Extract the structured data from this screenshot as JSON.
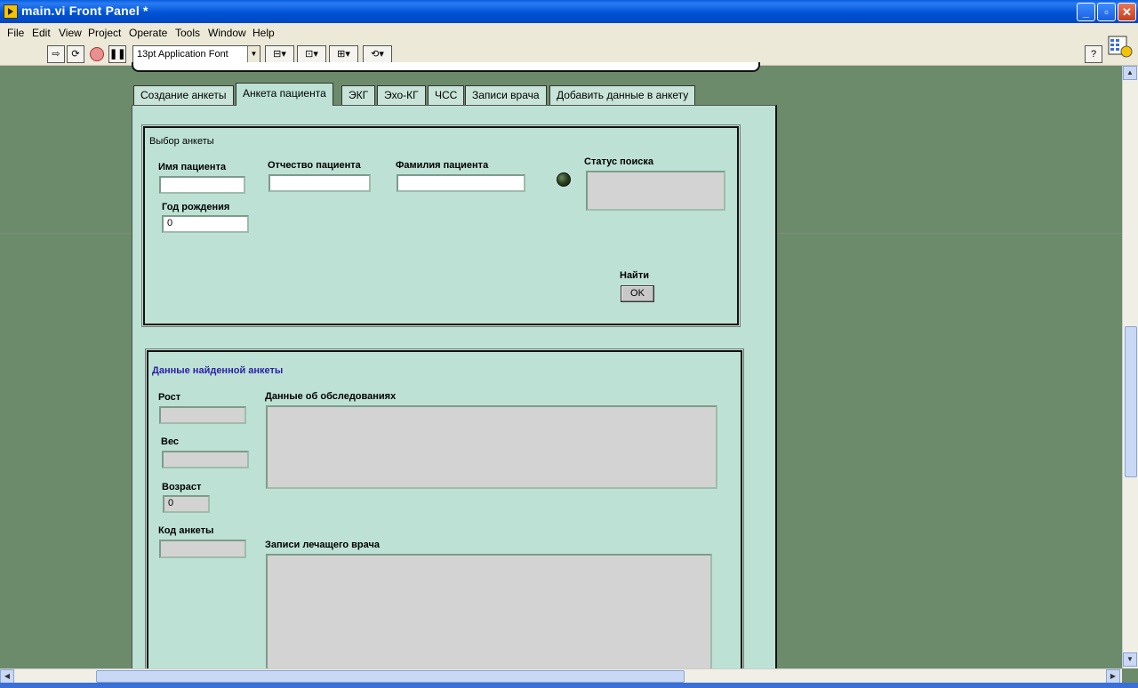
{
  "window": {
    "title": "main.vi Front Panel *"
  },
  "menu": [
    "File",
    "Edit",
    "View",
    "Project",
    "Operate",
    "Tools",
    "Window",
    "Help"
  ],
  "toolbar": {
    "font": "13pt Application Font"
  },
  "tabs": [
    "Создание анкеты",
    "Анкета пациента",
    "ЭКГ",
    "Эхо-КГ",
    "ЧСС",
    "Записи врача",
    "Добавить данные в анкету"
  ],
  "search_group": {
    "title": "Выбор анкеты",
    "first_name_label": "Имя пациента",
    "first_name_value": "",
    "patronymic_label": "Отчество пациента",
    "patronymic_value": "",
    "surname_label": "Фамилия пациента",
    "surname_value": "",
    "birth_year_label": "Год рождения",
    "birth_year_value": "0",
    "status_label": "Статус поиска",
    "status_value": "",
    "find_label": "Найти",
    "ok_label": "OK"
  },
  "result_group": {
    "title": "Данные найденной анкеты",
    "height_label": "Рост",
    "weight_label": "Вес",
    "age_label": "Возраст",
    "age_value": "0",
    "code_label": "Код анкеты",
    "exams_label": "Данные об обследованиях",
    "doctor_notes_label": "Записи лечащего врача"
  },
  "colors": {
    "panel_bg": "#bde2d5",
    "canvas_bg": "#6b8b6b",
    "result_title": "#2b1fa6"
  }
}
